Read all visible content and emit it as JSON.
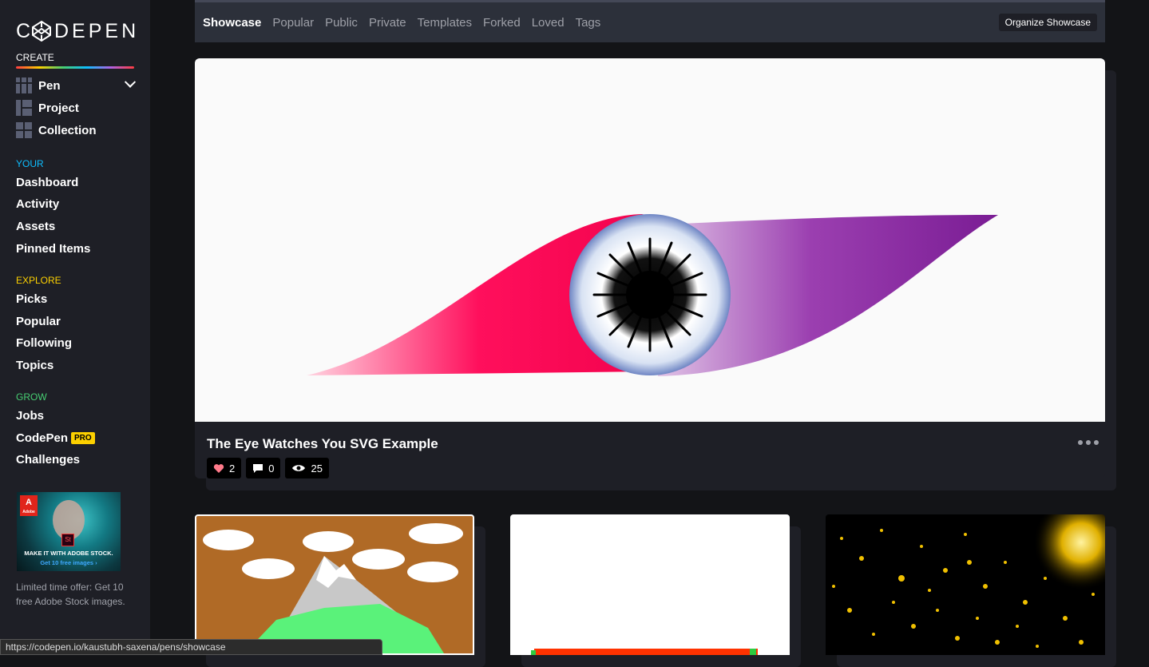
{
  "sidebar": {
    "logo_text": "C⬡DEPEN",
    "create_label": "CREATE",
    "create_items": [
      {
        "label": "Pen",
        "icon": "pen-grid-icon"
      },
      {
        "label": "Project",
        "icon": "project-grid-icon"
      },
      {
        "label": "Collection",
        "icon": "collection-grid-icon"
      }
    ],
    "your_label": "YOUR",
    "your_items": [
      "Dashboard",
      "Activity",
      "Assets",
      "Pinned Items"
    ],
    "explore_label": "EXPLORE",
    "explore_items": [
      "Picks",
      "Popular",
      "Following",
      "Topics"
    ],
    "grow_label": "GROW",
    "grow_items": [
      "Jobs",
      "CodePen",
      "Challenges"
    ],
    "pro_badge": "PRO",
    "ad": {
      "brand": "Adobe",
      "brand_letter": "A",
      "product_badge": "St",
      "line1": "MAKE IT WITH ADOBE STOCK.",
      "line2": "Get 10 free images ›",
      "text": "Limited time offer: Get 10 free Adobe Stock images."
    }
  },
  "tabs": {
    "items": [
      "Showcase",
      "Popular",
      "Public",
      "Private",
      "Templates",
      "Forked",
      "Loved",
      "Tags"
    ],
    "active": "Showcase",
    "organize_label": "Organize Showcase"
  },
  "hero": {
    "title": "The Eye Watches You SVG Example",
    "likes": "2",
    "comments": "0",
    "views": "25"
  },
  "status_bar": {
    "url": "https://codepen.io/kaustubh-saxena/pens/showcase"
  },
  "colors": {
    "create_accent": "#ffffff",
    "your_accent": "#0ebeff",
    "explore_accent": "#fcd000",
    "grow_accent": "#47cf73"
  }
}
